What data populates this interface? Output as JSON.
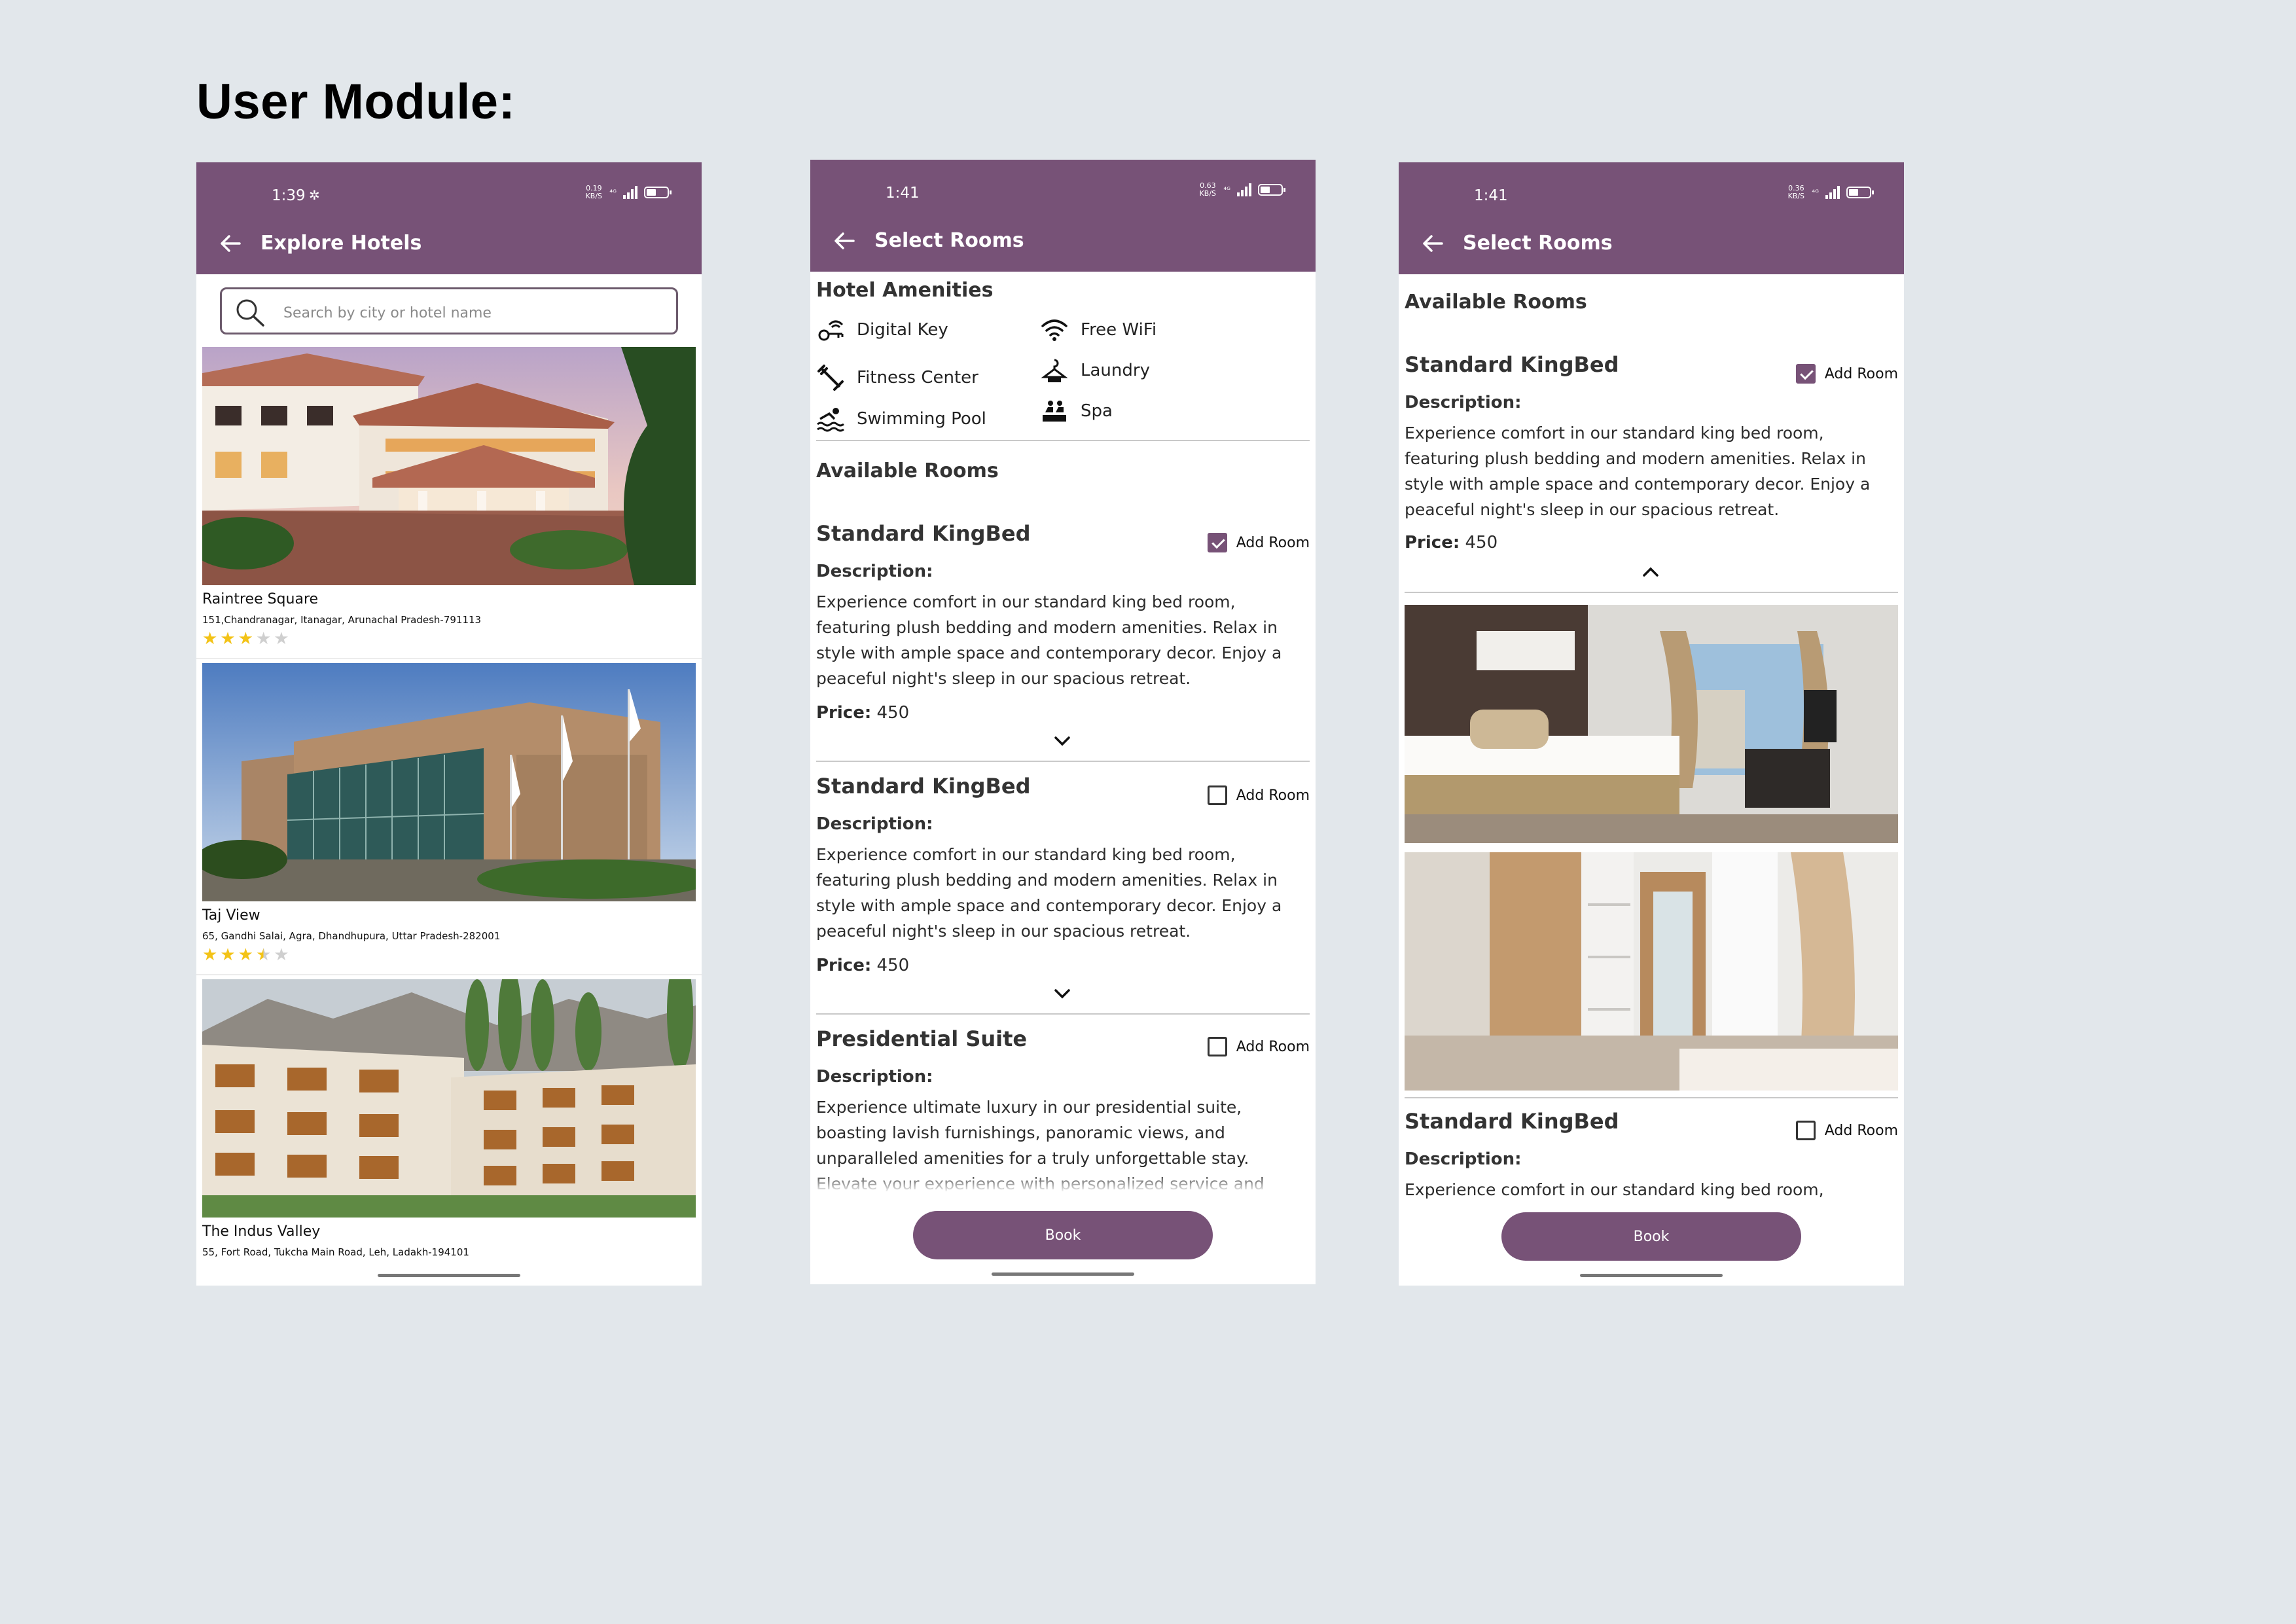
{
  "heading": "User Module:",
  "screen1": {
    "status_time": "1:39",
    "net_speed": "0.19 KB/S",
    "title": "Explore Hotels",
    "search_placeholder": "Search by city or hotel name",
    "hotels": [
      {
        "name": "Raintree Square",
        "address": "151,Chandranagar, Itanagar, Arunachal Pradesh-791113",
        "rating": 3,
        "rating_max": 5
      },
      {
        "name": "Taj View",
        "address": "65, Gandhi Salai, Agra, Dhandhupura, Uttar Pradesh-282001",
        "rating": 3.5,
        "rating_max": 5
      },
      {
        "name": "The Indus Valley",
        "address": "55, Fort Road, Tukcha Main Road, Leh, Ladakh-194101"
      }
    ]
  },
  "screen2": {
    "status_time": "1:41",
    "net_speed": "0.63 KB/S",
    "title": "Select Rooms",
    "amenities_title": "Hotel Amenities",
    "amenities": [
      {
        "label": "Digital Key",
        "icon": "digital-key-icon"
      },
      {
        "label": "Free WiFi",
        "icon": "wifi-icon"
      },
      {
        "label": "Fitness Center",
        "icon": "fitness-icon"
      },
      {
        "label": "Laundry",
        "icon": "laundry-icon"
      },
      {
        "label": "Swimming Pool",
        "icon": "pool-icon"
      },
      {
        "label": "Spa",
        "icon": "spa-icon"
      }
    ],
    "rooms_title": "Available Rooms",
    "rooms": [
      {
        "name": "Standard KingBed",
        "desc_label": "Description:",
        "desc": "Experience comfort in our standard king bed room, featuring plush bedding and modern amenities. Relax in style with ample space and contemporary decor. Enjoy a peaceful night's sleep in our spacious retreat.",
        "price_label": "Price:",
        "price": "450",
        "add_label": "Add Room",
        "checked": true
      },
      {
        "name": "Standard KingBed",
        "desc_label": "Description:",
        "desc": "Experience comfort in our standard king bed room, featuring plush bedding and modern amenities. Relax in style with ample space and contemporary decor. Enjoy a peaceful night's sleep in our spacious retreat.",
        "price_label": "Price:",
        "price": "450",
        "add_label": "Add Room",
        "checked": false
      },
      {
        "name": "Presidential Suite",
        "desc_label": "Description:",
        "desc": "Experience ultimate luxury in our presidential suite, boasting lavish furnishings, panoramic views, and unparalleled amenities for a truly unforgettable stay. Elevate your experience with personalized service and",
        "add_label": "Add Room",
        "checked": false
      }
    ],
    "book_label": "Book"
  },
  "screen3": {
    "status_time": "1:41",
    "net_speed": "0.36 KB/S",
    "title": "Select Rooms",
    "rooms_title": "Available Rooms",
    "rooms": [
      {
        "name": "Standard KingBed",
        "desc_label": "Description:",
        "desc": "Experience comfort in our standard king bed room, featuring plush bedding and modern amenities. Relax in style with ample space and contemporary decor. Enjoy a peaceful night's sleep in our spacious retreat.",
        "price_label": "Price:",
        "price": "450",
        "add_label": "Add Room",
        "checked": true
      },
      {
        "name": "Standard KingBed",
        "desc_label": "Description:",
        "desc": "Experience comfort in our standard king bed room,",
        "add_label": "Add Room",
        "checked": false
      }
    ],
    "book_label": "Book"
  },
  "colors": {
    "brand": "#775277",
    "star": "#f3c317",
    "background": "#e2e7eb"
  }
}
